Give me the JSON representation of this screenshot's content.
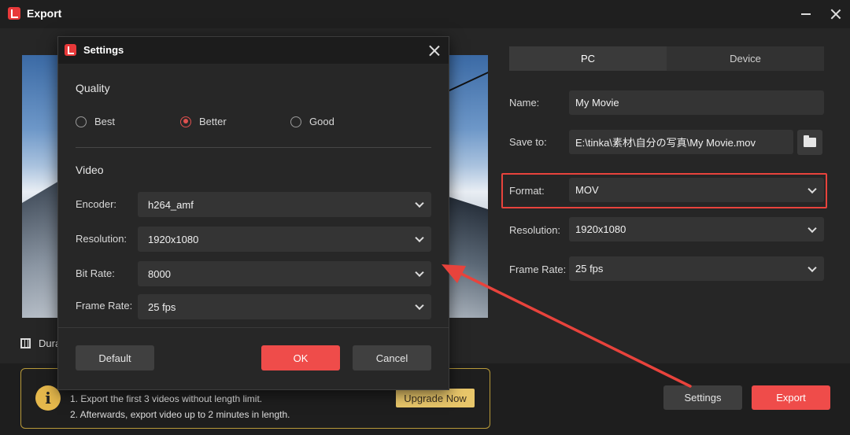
{
  "window": {
    "title": "Export",
    "logo_icon": "app-logo-icon",
    "minimize_icon": "minimize-icon",
    "close_icon": "close-icon"
  },
  "preview": {
    "duration_label": "Dura"
  },
  "tabs": [
    {
      "label": "PC",
      "active": true
    },
    {
      "label": "Device",
      "active": false
    }
  ],
  "form": {
    "name_label": "Name:",
    "name_value": "My Movie",
    "save_to_label": "Save to:",
    "save_to_value": "E:\\tinka\\素材\\自分の写真\\My Movie.mov",
    "format_label": "Format:",
    "format_value": "MOV",
    "resolution_label": "Resolution:",
    "resolution_value": "1920x1080",
    "frame_rate_label": "Frame Rate:",
    "frame_rate_value": "25 fps"
  },
  "notice": {
    "line1": "1. Export the first 3 videos without length limit.",
    "line2": "2. Afterwards, export video up to 2 minutes in length.",
    "upgrade_label": "Upgrade Now",
    "accent_color": "#e5b84c"
  },
  "actions": {
    "settings_label": "Settings",
    "export_label": "Export",
    "export_color": "#ef4c4a"
  },
  "dialog": {
    "title": "Settings",
    "quality_title": "Quality",
    "quality_options": [
      {
        "label": "Best",
        "selected": false
      },
      {
        "label": "Better",
        "selected": true
      },
      {
        "label": "Good",
        "selected": false
      }
    ],
    "video_title": "Video",
    "encoder_label": "Encoder:",
    "encoder_value": "h264_amf",
    "resolution_label": "Resolution:",
    "resolution_value": "1920x1080",
    "bitrate_label": "Bit Rate:",
    "bitrate_value": "8000",
    "frame_rate_label": "Frame Rate:",
    "frame_rate_value": "25 fps",
    "default_label": "Default",
    "ok_label": "OK",
    "cancel_label": "Cancel"
  },
  "annotation": {
    "highlight_color": "#e8433c"
  }
}
